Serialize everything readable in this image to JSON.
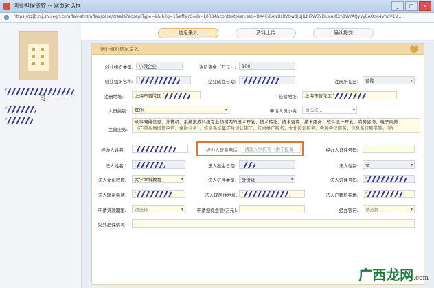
{
  "window": {
    "title": "创业担保贷款 -- 网页对话框",
    "url": "https://zzjb.rsj.sh.cegn.cn/affair-shrs/affair/case/create?acceptType=2&jb2q=1&affairCode=L0084&contextoken.sso=BX4CdiAwBsRVOwdiUJILbI7WSYDLwAXCm1WYAQyVyEAOge4VndV1V...",
    "buttons": [
      "_",
      "□",
      "×"
    ]
  },
  "sidebar": {
    "company_suffix": "司"
  },
  "tabs": [
    {
      "label": "信息录入",
      "active": true
    },
    {
      "label": "资料上传",
      "active": false
    },
    {
      "label": "确认提交",
      "active": false
    }
  ],
  "panel": {
    "header": "创业组织信息录入",
    "collapse_icon": "^"
  },
  "form": {
    "org_type_label": "创业组织类型:",
    "org_type_value": "小微企业",
    "reg_capital_label": "注册资金（万元）:",
    "reg_capital_value": "100",
    "org_name_label": "创业组织名称:",
    "found_date_label": "企业成立日期:",
    "reg_district_label": "注册所在区:",
    "reg_district_value": "普陀",
    "reg_addr_label": "注册地址:",
    "reg_addr_value": "上海市普陀区",
    "biz_addr_label": "经营地址:",
    "biz_addr_value": "上海市普陀区",
    "staff_type_label": "人员类别:",
    "staff_type_value": "其他",
    "applicant_type_label": "申请人员小类:",
    "applicant_type_value": "请选择...",
    "main_biz_label": "主营业务:",
    "main_biz_line1": "从事网络信息、计算机、系统集成科技专业领域内的技术开发、技术转让、技术咨询、技术服务，软件设计开发，商务咨询，电子商务",
    "main_biz_line2": "（不得从事增值电信、金融业务），信息系统集成及设计施工，技术推广服务，文化设计服务，会展会议服务，信息系统服务等。（依",
    "handler_name_label": "经办人姓名:",
    "handler_phone_label": "经办人联系电话:",
    "handler_phone_placeholder": "请输入手机号（用于接受",
    "handler_id_label": "经办人证件号码:",
    "legal_name_label": "法人姓名:",
    "legal_birth_label": "法人出生日期:",
    "legal_gender_label": "法人性别:",
    "legal_gender_value": "女",
    "legal_edu_label": "法人文化程度:",
    "legal_edu_value": "大学本科教育",
    "legal_id_type_label": "法人证件类型:",
    "legal_id_type_value": "身份证",
    "legal_id_label": "法人证件号码:",
    "legal_phone_label": "法人联系电话:",
    "legal_addr_label": "法人现居住地址:",
    "legal_hukou_label": "法人户籍所在地:",
    "loan_term_label": "申请贷款期限:",
    "loan_term_value": "请选择...",
    "loan_amount_label": "申请担保金额(万元):",
    "bank_label": "经办银行:",
    "bank_value": "请选择...",
    "guarantee_label": "对外担保情况:"
  },
  "watermark": {
    "brand": "广西龙网",
    "domain": ".com"
  },
  "colors": {
    "accent": "#e8742d",
    "header": "#f1d9a6"
  }
}
